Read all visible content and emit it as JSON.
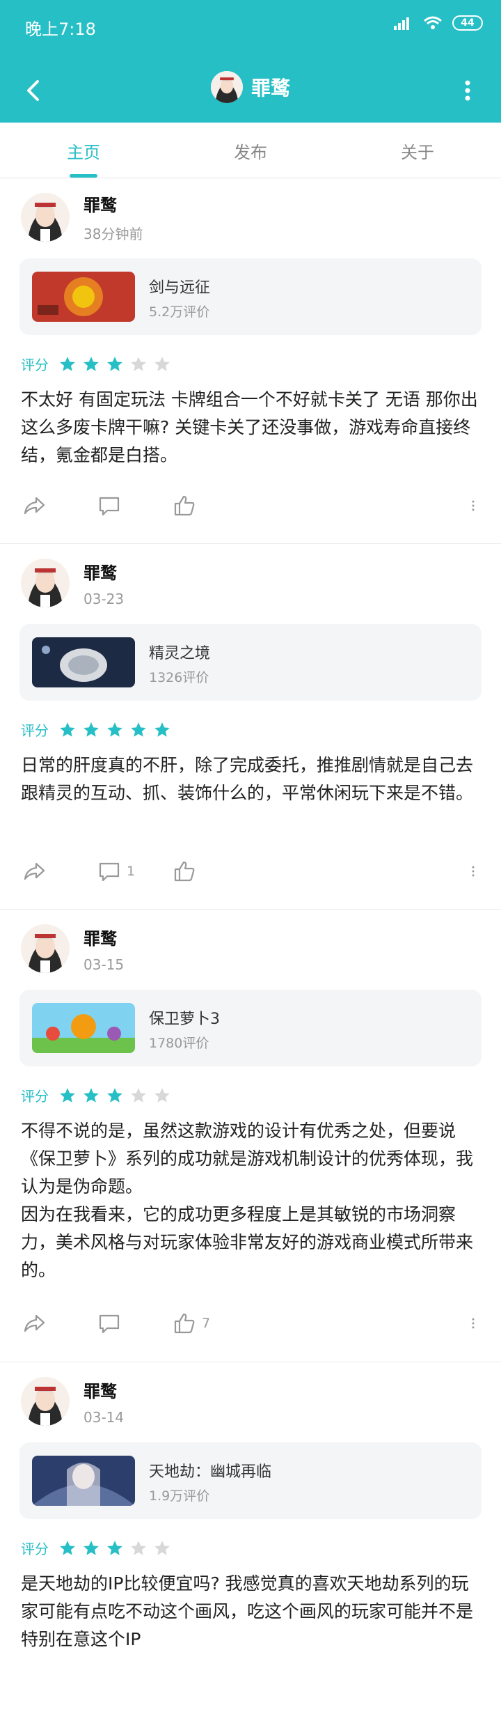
{
  "status_bar": {
    "time": "晚上7:18",
    "battery": "44"
  },
  "header": {
    "title": "罪鹜"
  },
  "tabs": [
    {
      "label": "主页",
      "active": true
    },
    {
      "label": "发布",
      "active": false
    },
    {
      "label": "关于",
      "active": false
    }
  ],
  "colors": {
    "accent": "#27bfc6",
    "star_off": "#d8d8d8"
  },
  "posts": [
    {
      "author": "罪鹜",
      "time": "38分钟前",
      "game_name": "剑与远征",
      "game_count": "5.2万评价",
      "rating_label": "评分",
      "rating": 3,
      "text": "不太好 有固定玩法 卡牌组合一个不好就卡关了 无语 那你出这么多废卡牌干嘛? 关键卡关了还没事做，游戏寿命直接终结，氪金都是白搭。",
      "comment_count": "",
      "like_count": ""
    },
    {
      "author": "罪鹜",
      "time": "03-23",
      "game_name": "精灵之境",
      "game_count": "1326评价",
      "rating_label": "评分",
      "rating": 5,
      "text": "日常的肝度真的不肝，除了完成委托，推推剧情就是自己去跟精灵的互动、抓、装饰什么的，平常休闲玩下来是不错。",
      "comment_count": "1",
      "like_count": ""
    },
    {
      "author": "罪鹜",
      "time": "03-15",
      "game_name": "保卫萝卜3",
      "game_count": "1780评价",
      "rating_label": "评分",
      "rating": 3,
      "text": "不得不说的是，虽然这款游戏的设计有优秀之处，但要说《保卫萝卜》系列的成功就是游戏机制设计的优秀体现，我认为是伪命题。\n因为在我看来，它的成功更多程度上是其敏锐的市场洞察力，美术风格与对玩家体验非常友好的游戏商业模式所带来的。",
      "comment_count": "",
      "like_count": "7"
    },
    {
      "author": "罪鹜",
      "time": "03-14",
      "game_name": "天地劫：幽城再临",
      "game_count": "1.9万评价",
      "rating_label": "评分",
      "rating": 3,
      "text": "是天地劫的IP比较便宜吗? 我感觉真的喜欢天地劫系列的玩家可能有点吃不动这个画风，吃这个画风的玩家可能并不是特别在意这个IP",
      "comment_count": "",
      "like_count": ""
    }
  ]
}
